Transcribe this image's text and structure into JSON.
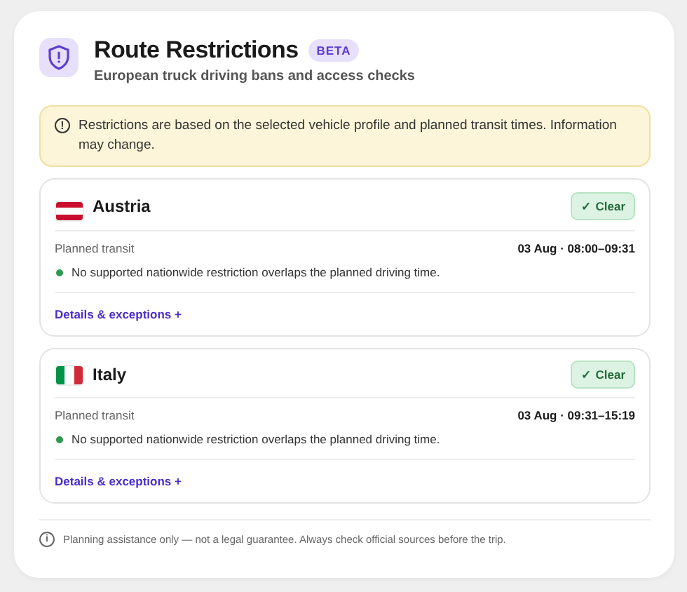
{
  "header": {
    "title": "Route Restrictions",
    "badge": "BETA",
    "subtitle": "European truck driving bans and access checks"
  },
  "notice": {
    "icon": "!",
    "text": "Restrictions are based on the selected vehicle profile and planned transit times. Information may change."
  },
  "countries": [
    {
      "name": "Austria",
      "flag": {
        "kind": "horizontal",
        "stripes": [
          {
            "color": "#c8102e"
          },
          {
            "color": "#ffffff"
          },
          {
            "color": "#c8102e"
          }
        ]
      },
      "status": {
        "kind": "clear",
        "label": "✓ Clear"
      },
      "transit_label": "Planned transit",
      "transit_time": "03 Aug · 08:00–09:31",
      "message": "No supported nationwide restriction overlaps the planned driving time.",
      "link": "Details & exceptions +"
    },
    {
      "name": "Italy",
      "flag": {
        "kind": "vertical",
        "stripes": [
          {
            "color": "#009246"
          },
          {
            "color": "#ffffff"
          },
          {
            "color": "#ce2b37"
          }
        ]
      },
      "status": {
        "kind": "clear",
        "label": "✓ Clear"
      },
      "transit_label": "Planned transit",
      "transit_time": "03 Aug · 09:31–15:19",
      "message": "No supported nationwide restriction overlaps the planned driving time.",
      "link": "Details & exceptions +"
    }
  ],
  "footer": {
    "icon": "i",
    "text": "Planning assistance only — not a legal guarantee. Always check official sources before the trip."
  }
}
